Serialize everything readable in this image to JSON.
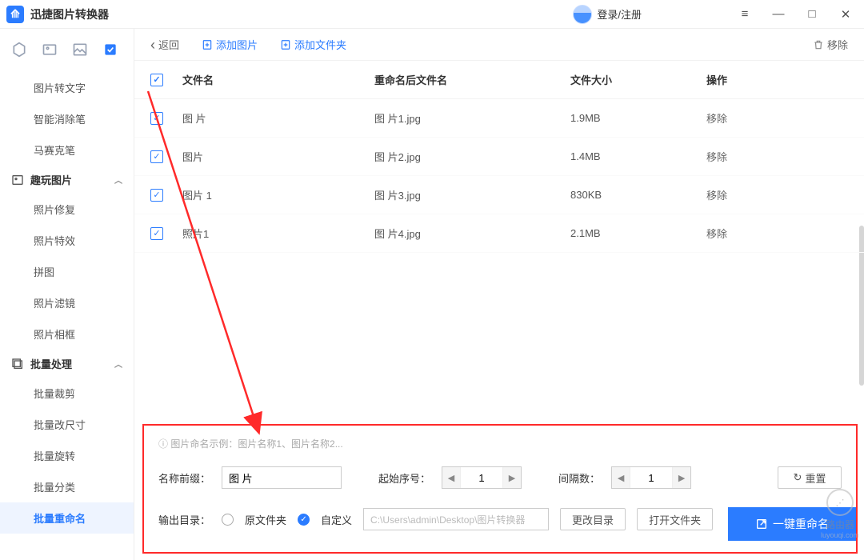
{
  "app": {
    "title": "迅捷图片转换器",
    "login": "登录/注册"
  },
  "toolbar": {
    "back": "返回",
    "add_image": "添加图片",
    "add_folder": "添加文件夹",
    "remove": "移除"
  },
  "columns": {
    "name": "文件名",
    "rename": "重命名后文件名",
    "size": "文件大小",
    "op": "操作"
  },
  "rows": [
    {
      "name": "图 片",
      "rename": "图 片1.jpg",
      "size": "1.9MB",
      "op": "移除"
    },
    {
      "name": "图片",
      "rename": "图 片2.jpg",
      "size": "1.4MB",
      "op": "移除"
    },
    {
      "name": "图片 1",
      "rename": "图 片3.jpg",
      "size": "830KB",
      "op": "移除"
    },
    {
      "name": "照片1",
      "rename": "图 片4.jpg",
      "size": "2.1MB",
      "op": "移除"
    }
  ],
  "sidebar": {
    "group1": [
      "图片转文字",
      "智能消除笔",
      "马赛克笔"
    ],
    "group2_title": "趣玩图片",
    "group2": [
      "照片修复",
      "照片特效",
      "拼图",
      "照片滤镜",
      "照片相框"
    ],
    "group3_title": "批量处理",
    "group3": [
      "批量裁剪",
      "批量改尺寸",
      "批量旋转",
      "批量分类",
      "批量重命名"
    ]
  },
  "bottom": {
    "hint": "图片命名示例：图片名称1、图片名称2...",
    "prefix_label": "名称前缀：",
    "prefix_value": "图 片",
    "start_label": "起始序号：",
    "start_value": "1",
    "gap_label": "间隔数：",
    "gap_value": "1",
    "reset": "重置",
    "output_label": "输出目录：",
    "original": "原文件夹",
    "custom": "自定义",
    "path": "C:\\Users\\admin\\Desktop\\图片转换器",
    "change_dir": "更改目录",
    "open_dir": "打开文件夹",
    "primary": "一键重命名"
  },
  "watermark": {
    "t1": "路由器",
    "t2": "luyouqi.com"
  }
}
